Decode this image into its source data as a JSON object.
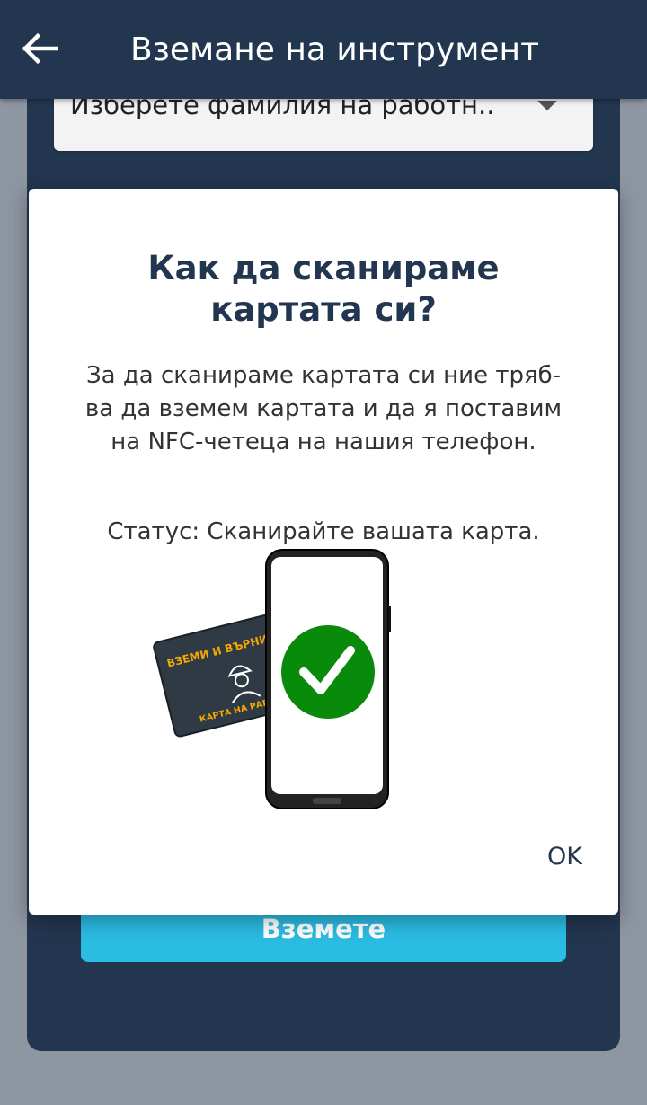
{
  "appbar": {
    "title": "Вземане на инструмент",
    "back_icon": "arrow-left-icon"
  },
  "form": {
    "employee_select_value": "Изберете фамилия на работн..",
    "take_button_label": "Вземете"
  },
  "dialog": {
    "title": "Как да сканираме картата си?",
    "body": "За да сканираме картата си ние тряб-ва да вземем картата и да я поставим на NFC-четеца на нашия телефон.",
    "status": "Статус: Сканирайте вашата карта.",
    "ok_label": "OK",
    "card_text_top": "ВЗЕМИ И ВЪРНИ",
    "card_text_bottom": "КАРТА НА РАБОТНИК",
    "check_color": "#0a8a0a"
  },
  "colors": {
    "primary": "#233650",
    "accent": "#2bbce3",
    "overlay": "#8e96a2"
  }
}
